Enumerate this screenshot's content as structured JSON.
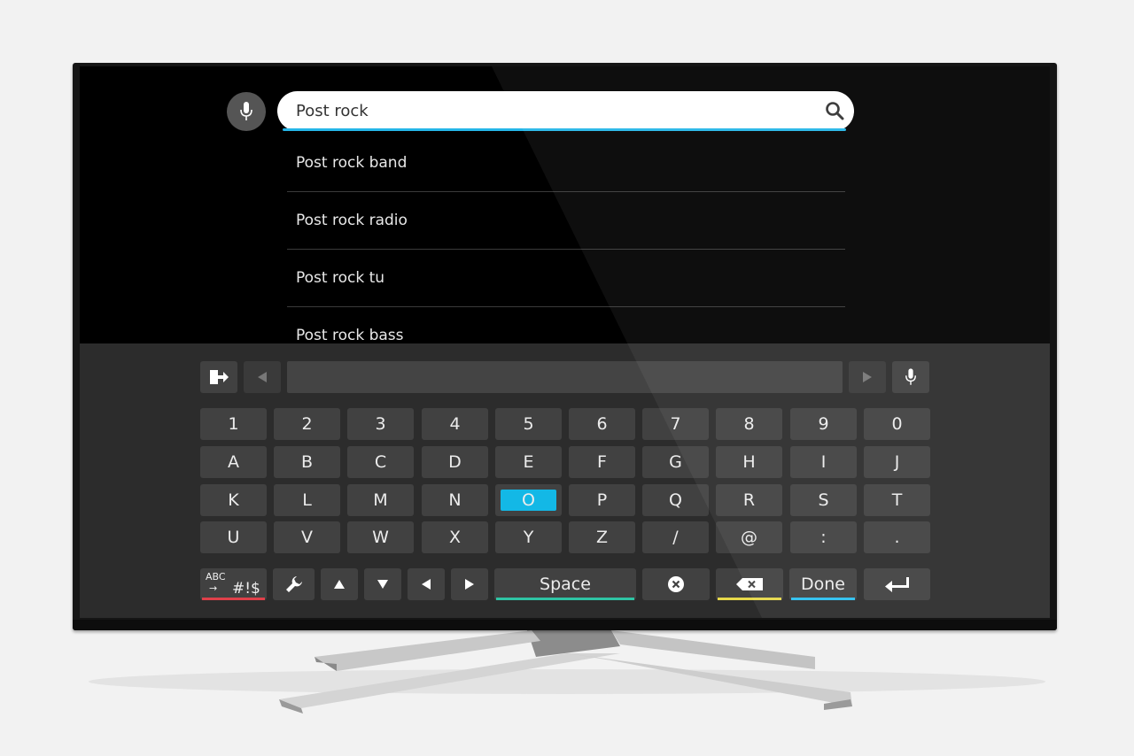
{
  "search": {
    "query": "Post rock"
  },
  "suggestions": [
    "Post rock band",
    "Post rock radio",
    "Post rock tu",
    "Post rock bass"
  ],
  "keyboard": {
    "rows": [
      [
        "1",
        "2",
        "3",
        "4",
        "5",
        "6",
        "7",
        "8",
        "9",
        "0"
      ],
      [
        "A",
        "B",
        "C",
        "D",
        "E",
        "F",
        "G",
        "H",
        "I",
        "J"
      ],
      [
        "K",
        "L",
        "M",
        "N",
        "O",
        "P",
        "Q",
        "R",
        "S",
        "T"
      ],
      [
        "U",
        "V",
        "W",
        "X",
        "Y",
        "Z",
        "/",
        "@",
        ":",
        "."
      ]
    ],
    "selected_key": "O",
    "mode_label_top": "ABC",
    "mode_label_bottom": "#!$",
    "space_label": "Space",
    "done_label": "Done"
  },
  "icons": {
    "search": "search-icon",
    "mic": "microphone-icon",
    "exit": "exit-icon",
    "left": "arrow-left-icon",
    "right": "arrow-right-icon",
    "settings": "wrench-icon",
    "up": "triangle-up-icon",
    "down": "triangle-down-icon",
    "clear": "clear-icon",
    "backspace": "backspace-icon",
    "enter": "enter-icon"
  },
  "colors": {
    "accent": "#13b8e6",
    "red": "#e0404a",
    "green": "#2ec4a4",
    "yellow": "#e6d84a",
    "blue": "#2cc0f0"
  }
}
